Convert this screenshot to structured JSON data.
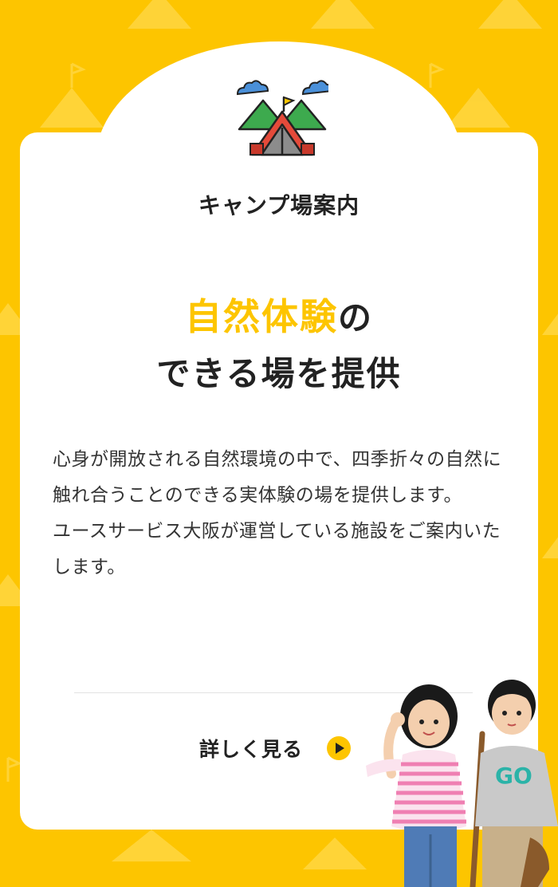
{
  "section": {
    "label": "キャンプ場案内"
  },
  "headline": {
    "accent": "自然体験",
    "line1_suffix": "の",
    "line2": "できる場を提供"
  },
  "body": {
    "paragraph1": "心身が開放される自然環境の中で、四季折々の自然に触れ合うことのできる実体験の場を提供します。",
    "paragraph2": "ユースサービス大阪が運営している施設をご案内いたします。"
  },
  "link": {
    "label": "詳しく見る"
  },
  "photo": {
    "shirt_text": "GO"
  },
  "colors": {
    "brand_yellow": "#fdc500",
    "text": "#222222"
  },
  "icons": {
    "camp": "camp-tent-icon",
    "arrow": "play-circle-icon"
  }
}
